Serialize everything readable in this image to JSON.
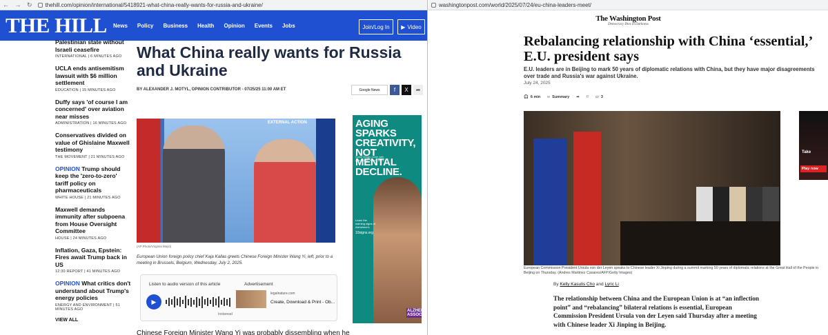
{
  "left": {
    "url": "thehill.com/opinion/international/5418921-what-china-really-wants-for-russia-and-ukraine/",
    "logo": "THE HILL",
    "nav": [
      "News",
      "Policy",
      "Business",
      "Health",
      "Opinion",
      "Events",
      "Jobs"
    ],
    "join": "Join/Log In",
    "video": "Video",
    "sidebar": [
      {
        "title": "Palestinian state without Israeli ceasefire",
        "meta": "INTERNATIONAL | 6 MINUTES AGO"
      },
      {
        "title": "UCLA ends antisemitism lawsuit with $6 million settlement",
        "meta": "EDUCATION | 15 MINUTES AGO"
      },
      {
        "title": "Duffy says 'of course I am concerned' over aviation near misses",
        "meta": "ADMINISTRATION | 16 MINUTES AGO"
      },
      {
        "title": "Conservatives divided on value of Ghislaine Maxwell testimony",
        "meta": "THE MOVEMENT | 21 MINUTES AGO"
      },
      {
        "prefix": "OPINION",
        "title": "Trump should keep the 'zero-to-zero' tariff policy on pharmaceuticals",
        "meta": "WHITE HOUSE | 21 MINUTES AGO"
      },
      {
        "title": "Maxwell demands immunity after subpoena from House Oversight Committee",
        "meta": "HOUSE | 24 MINUTES AGO"
      },
      {
        "title": "Inflation, Gaza, Epstein: Fires await Trump back in US",
        "meta": "12:30 REPORT | 41 MINUTES AGO"
      },
      {
        "prefix": "OPINION",
        "title": "What critics don't understand about Trump's energy policies",
        "meta": "ENERGY AND ENVIRONMENT | 51 MINUTES AGO"
      }
    ],
    "viewall": "VIEW ALL",
    "headline": "What China really wants for Russia and Ukraine",
    "byline": "BY ALEXANDER J. MOTYL, OPINION CONTRIBUTOR - 07/25/25 11:00 AM ET",
    "share_google": "Google News",
    "photo_banner": "EXTERNAL ACTION",
    "credit": "(AP Photo/Virginia Mayo)",
    "caption": "European Union foreign policy chief Kaja Kallas greets Chinese Foreign Minister Wang Yi, left, prior to a meeting in Brussels, Belgium, Wednesday, July 2, 2025.",
    "audio_label": "Listen to audio version of this article",
    "ad_label": "Advertisement",
    "ad_domain": "legalnature.com",
    "ad_text": "Create, Download & Print - Ob...",
    "instaread": "Instaread",
    "body_start": "Chinese Foreign Minister Wang Yi was probably dissembling when he",
    "ad_title_1": "AGING SPARKS",
    "ad_title_2": "CREATIVITY,",
    "ad_title_3": "NOT MENTAL",
    "ad_title_4": "DECLINE.",
    "ad_sub": "Some things come with age. Some others don't.",
    "ad_learn": "Learn the warning signs of Alzheimer's",
    "ad_url": "10signs.org",
    "ad_alz": "ALZHEI ASSOCI"
  },
  "right": {
    "url": "washingtonpost.com/world/2025/07/24/eu-china-leaders-meet/",
    "logo": "The Washington Post",
    "tagline": "Democracy Dies in Darkness",
    "headline": "Rebalancing relationship with China ‘essential,’ E.U. president says",
    "dek": "E.U. leaders are in Beijing to mark 50 years of diplomatic relations with China, but they have major disagreements over trade and Russia's war against Ukraine.",
    "date": "July 24, 2025",
    "tools": {
      "time": "6 min",
      "summary": "Summary",
      "comments": "3"
    },
    "caption": "European Commission President Ursula von der Leyen speaks to Chinese leader Xi Jinping during a summit marking 50 years of diplomatic relations at the Great Hall of the People in Beijing on Thursday. (Andres Martinez Casares/AFP/Getty Images)",
    "by": "By",
    "author1": "Kelly Kasulis Cho",
    "and": "and",
    "author2": "Lyric Li",
    "body": "The relationship between China and the European Union is at “an inflection point” and “rebalancing” bilateral relations is essential, European Commission President Ursula von der Leyen said Thursday after a meeting with Chinese leader Xi Jinping in Beijing.",
    "ad_text": "Take",
    "ad_btn": "Play now"
  }
}
